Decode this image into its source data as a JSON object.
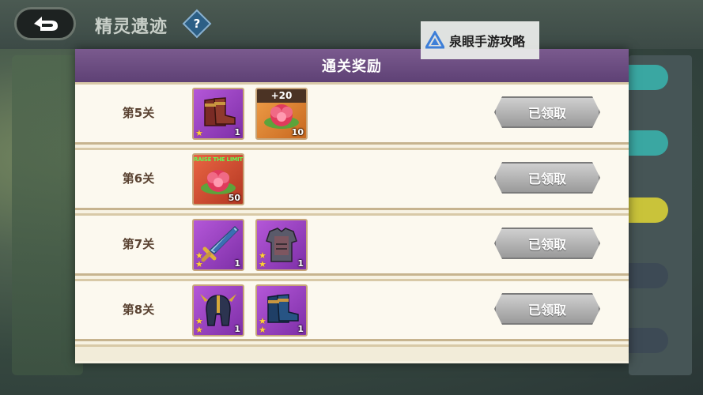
{
  "page": {
    "title": "精灵遗迹",
    "help_symbol": "?"
  },
  "watermark": {
    "text": "泉眼手游攻略"
  },
  "modal": {
    "title": "通关奖励",
    "rows": [
      {
        "label": "第5关",
        "button": "已领取",
        "items": [
          {
            "icon": "boots-icon",
            "rarity": "purple",
            "stars": 1,
            "count": "1"
          },
          {
            "icon": "flower-icon",
            "rarity": "orange",
            "badge": "+20",
            "count": "10"
          }
        ]
      },
      {
        "label": "第6关",
        "button": "已领取",
        "items": [
          {
            "icon": "flower-icon",
            "rarity": "red",
            "banner": "RAISE THE LIMIT",
            "count": "50"
          }
        ]
      },
      {
        "label": "第7关",
        "button": "已领取",
        "items": [
          {
            "icon": "sword-icon",
            "rarity": "purple",
            "stars": 2,
            "count": "1"
          },
          {
            "icon": "armor-icon",
            "rarity": "purple",
            "stars": 2,
            "count": "1"
          }
        ]
      },
      {
        "label": "第8关",
        "button": "已领取",
        "items": [
          {
            "icon": "helmet-icon",
            "rarity": "purple",
            "stars": 2,
            "count": "1"
          },
          {
            "icon": "boots-icon",
            "rarity": "purple",
            "stars": 2,
            "count": "1"
          }
        ]
      }
    ]
  },
  "colors": {
    "header": "#6a4c80",
    "row_bg": "#fcf9ef",
    "button": "#b5b5b5"
  }
}
